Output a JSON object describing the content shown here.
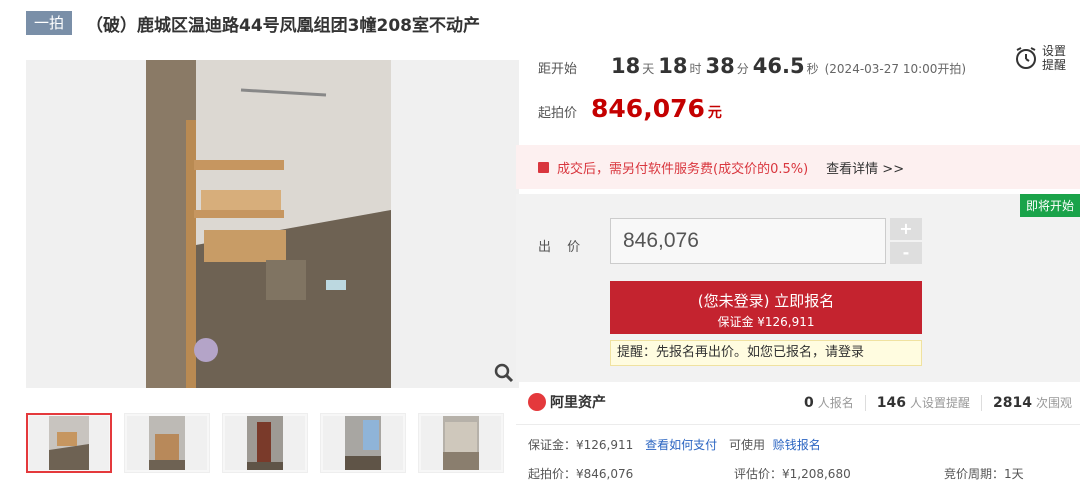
{
  "title": {
    "badge": "一拍",
    "text": "（破）鹿城区温迪路44号凤凰组团3幢208室不动产"
  },
  "countdown": {
    "label": "距开始",
    "days": "18",
    "days_unit": "天",
    "hours": "18",
    "hours_unit": "时",
    "minutes": "38",
    "minutes_unit": "分",
    "seconds": "46.5",
    "seconds_unit": "秒",
    "start_note": "(2024-03-27 10:00开拍)"
  },
  "reminder": {
    "label": "设置提醒",
    "icon": "alarm-clock-icon"
  },
  "start_price": {
    "label": "起拍价",
    "value": "846,076",
    "unit": "元"
  },
  "notice": {
    "text": "成交后，需另付软件服务费(成交价的0.5%)",
    "link": "查看详情 >>"
  },
  "bid": {
    "status_tag": "即将开始",
    "label": "出 价",
    "value": "846,076",
    "plus": "+",
    "minus": "-",
    "signup_main": "(您未登录) 立即报名",
    "signup_sub": "保证金 ¥126,911",
    "tip": "提醒：先报名再出价。如您已报名，请登录"
  },
  "stats": {
    "brand": "阿里资产",
    "signups": "0",
    "signups_label": "人报名",
    "reminders": "146",
    "reminders_label": "人设置提醒",
    "views": "2814",
    "views_label": "次围观"
  },
  "details": {
    "deposit": "保证金：¥126,911",
    "how_to_pay": "查看如何支付",
    "available": "可使用",
    "loan_signup": "赊钱报名",
    "start_price": "起拍价：¥846,076",
    "appraisal": "评估价：¥1,208,680",
    "cycle": "竞价周期：1天"
  },
  "colors": {
    "accent_red": "#c4232f",
    "price_red": "#c40000",
    "link_blue": "#2b65c2",
    "soon_green": "#1aa34a"
  }
}
